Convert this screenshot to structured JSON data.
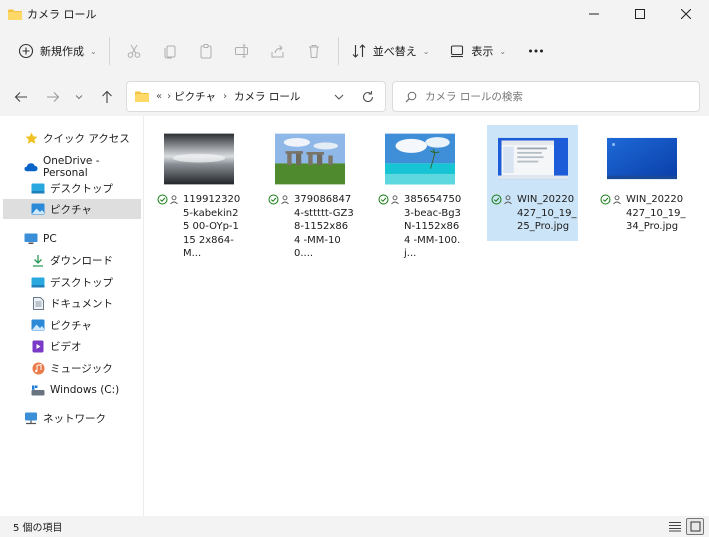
{
  "window": {
    "title": "カメラ ロール",
    "controls": [
      "minimize",
      "maximize",
      "close"
    ]
  },
  "toolbar": {
    "new_label": "新規作成",
    "sort_label": "並べ替え",
    "view_label": "表示",
    "icons": [
      "cut-icon",
      "copy-icon",
      "paste-icon",
      "rename-icon",
      "share-icon",
      "delete-icon"
    ]
  },
  "address": {
    "overflow": "«",
    "crumbs": [
      "ピクチャ",
      "カメラ ロール"
    ]
  },
  "search": {
    "placeholder": "カメラ ロールの検索"
  },
  "sidebar": {
    "quick_access": "クイック アクセス",
    "onedrive": "OneDrive - Personal",
    "onedrive_items": [
      "デスクトップ",
      "ピクチャ"
    ],
    "pc": "PC",
    "pc_items": [
      "ダウンロード",
      "デスクトップ",
      "ドキュメント",
      "ピクチャ",
      "ビデオ",
      "ミュージック",
      "Windows (C:)"
    ],
    "network": "ネットワーク",
    "selected": "ピクチャ"
  },
  "files": [
    {
      "name": "119912320 5-kabekin25 00-OYp-115 2x864-M...",
      "thumb": "dark-sea"
    },
    {
      "name": "379086847 4-sttttt-GZ3 8-1152x864 -MM-100....",
      "thumb": "stonehenge"
    },
    {
      "name": "385654750 3-beac-Bg3 N-1152x864 -MM-100.j...",
      "thumb": "beach"
    },
    {
      "name": "WIN_20220 427_10_19_ 25_Pro.jpg",
      "thumb": "screenshot"
    },
    {
      "name": "WIN_20220 427_10_19_ 34_Pro.jpg",
      "thumb": "blue-desktop"
    }
  ],
  "status": {
    "count": "5 個の項目"
  },
  "colors": {
    "accent": "#0067c0",
    "selected_file": "#cce4f7",
    "sync_green": "#0f7b0f"
  }
}
